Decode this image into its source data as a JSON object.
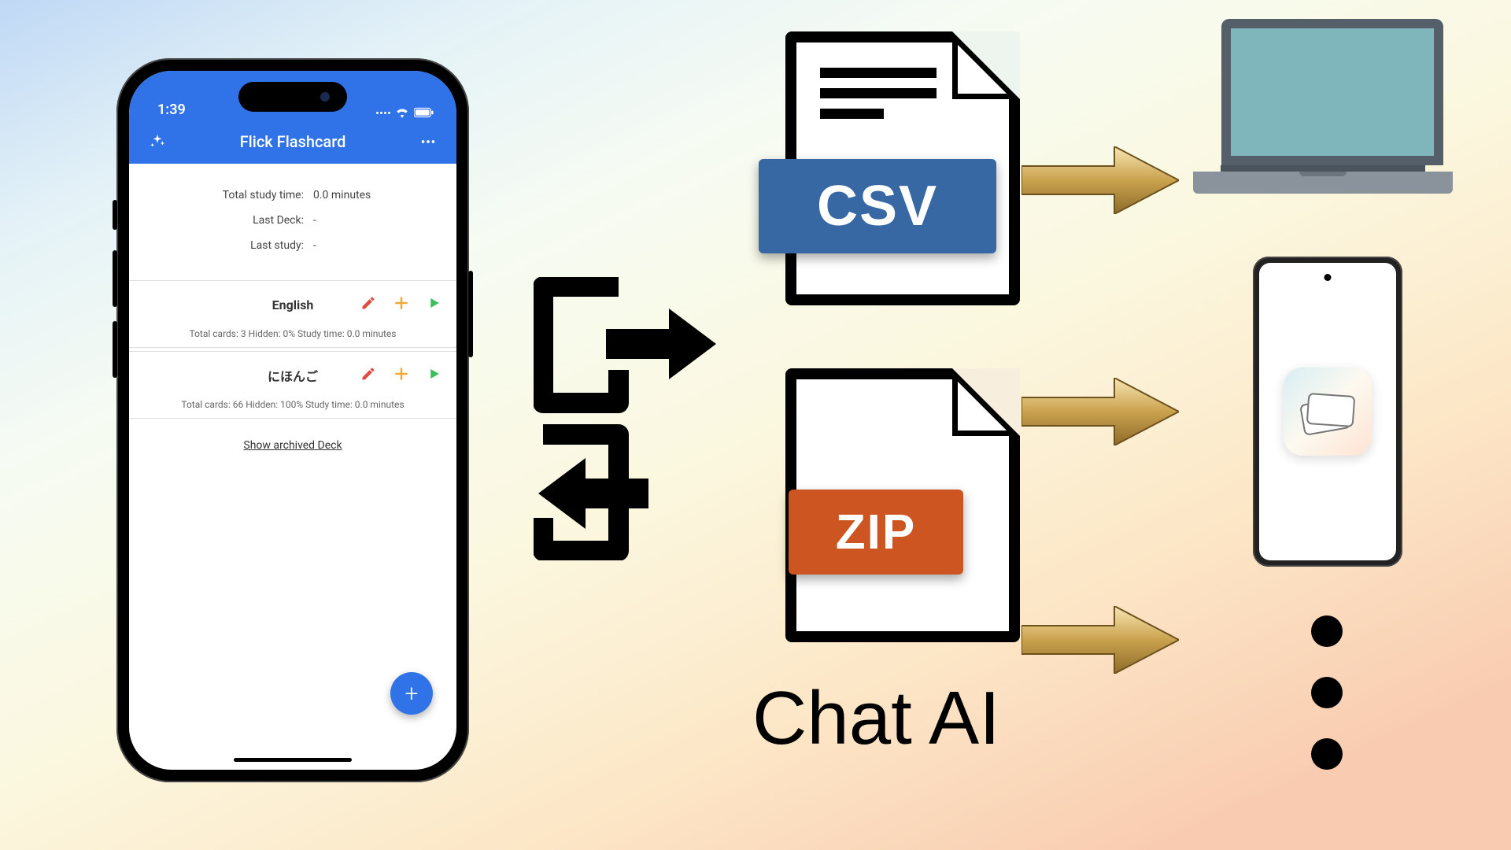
{
  "status_bar": {
    "time": "1:39"
  },
  "app_bar": {
    "title": "Flick Flashcard"
  },
  "stats": {
    "total_study_label": "Total study time:",
    "total_study_value": "0.0 minutes",
    "last_deck_label": "Last Deck:",
    "last_deck_value": "-",
    "last_study_label": "Last study:",
    "last_study_value": "-"
  },
  "decks": [
    {
      "title": "English",
      "meta": "Total cards: 3   Hidden: 0%   Study time: 0.0 minutes"
    },
    {
      "title": "にほんご",
      "meta": "Total cards: 66   Hidden: 100%   Study time: 0.0 minutes"
    }
  ],
  "archived_link": "Show archived Deck",
  "file_labels": {
    "csv": "CSV",
    "zip": "ZIP"
  },
  "chat_ai_label": "Chat AI"
}
